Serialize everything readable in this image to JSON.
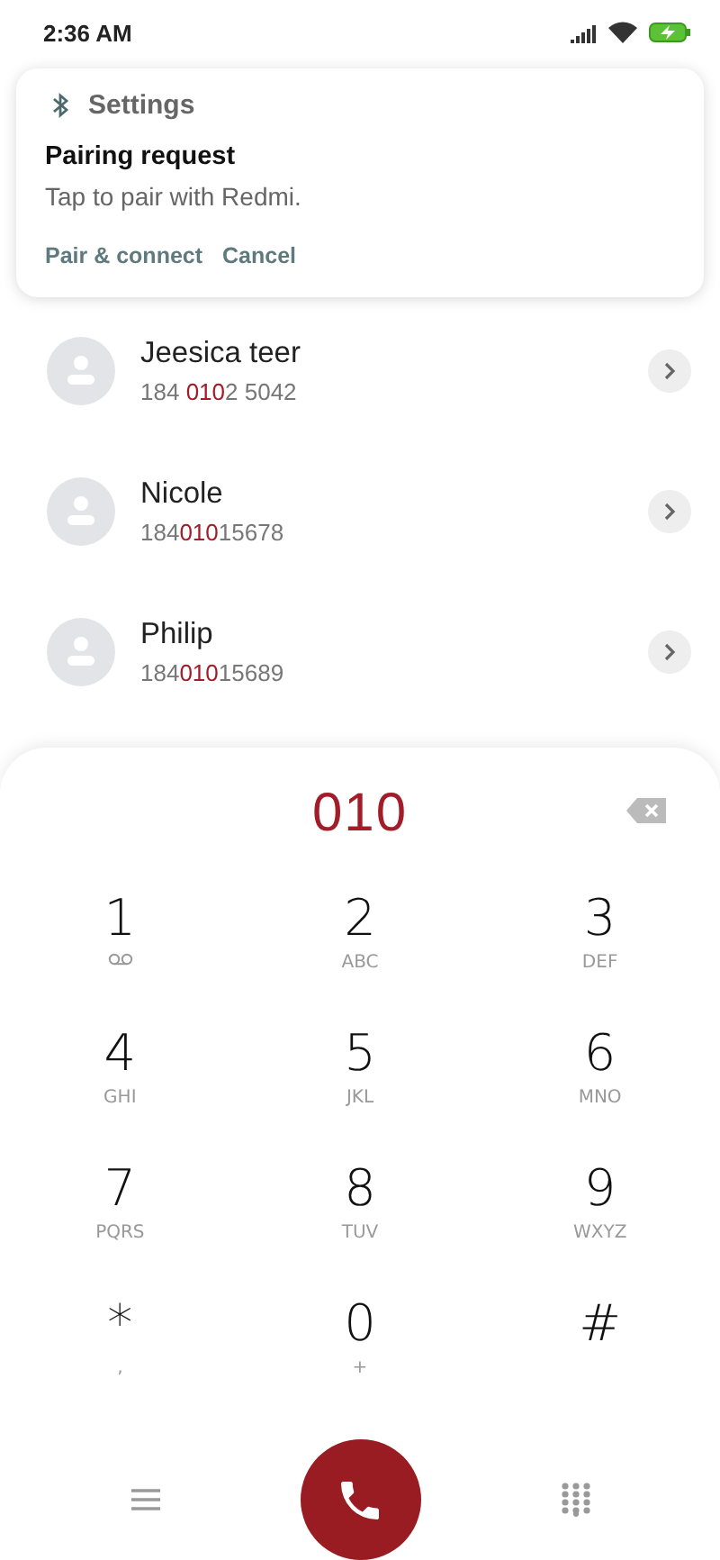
{
  "status_bar": {
    "time": "2:36 AM"
  },
  "notification": {
    "app": "Settings",
    "title": "Pairing request",
    "body": "Tap to pair with Redmi.",
    "actions": [
      "Pair & connect",
      "Cancel"
    ]
  },
  "contacts": [
    {
      "name": "Jeesica teer",
      "number": {
        "before": "184 ",
        "match": "010",
        "after": "2 5042"
      }
    },
    {
      "name": "Nicole",
      "number": {
        "before": "184",
        "match": "010",
        "after": "15678"
      }
    },
    {
      "name": "Philip",
      "number": {
        "before": "184",
        "match": "010",
        "after": "15689"
      }
    }
  ],
  "dialer": {
    "entered": "010",
    "keys": [
      {
        "digit": "1",
        "kind": "voicemail"
      },
      {
        "digit": "2",
        "kind": "letters",
        "sub": "ABC"
      },
      {
        "digit": "3",
        "kind": "letters",
        "sub": "DEF"
      },
      {
        "digit": "4",
        "kind": "letters",
        "sub": "GHI"
      },
      {
        "digit": "5",
        "kind": "letters",
        "sub": "JKL"
      },
      {
        "digit": "6",
        "kind": "letters",
        "sub": "MNO"
      },
      {
        "digit": "7",
        "kind": "letters",
        "sub": "PQRS"
      },
      {
        "digit": "8",
        "kind": "letters",
        "sub": "TUV"
      },
      {
        "digit": "9",
        "kind": "letters",
        "sub": "WXYZ"
      },
      {
        "digit": "*",
        "kind": "letters",
        "sub": ","
      },
      {
        "digit": "0",
        "kind": "letters",
        "sub": "+"
      },
      {
        "digit": "#",
        "kind": "plain"
      }
    ]
  }
}
